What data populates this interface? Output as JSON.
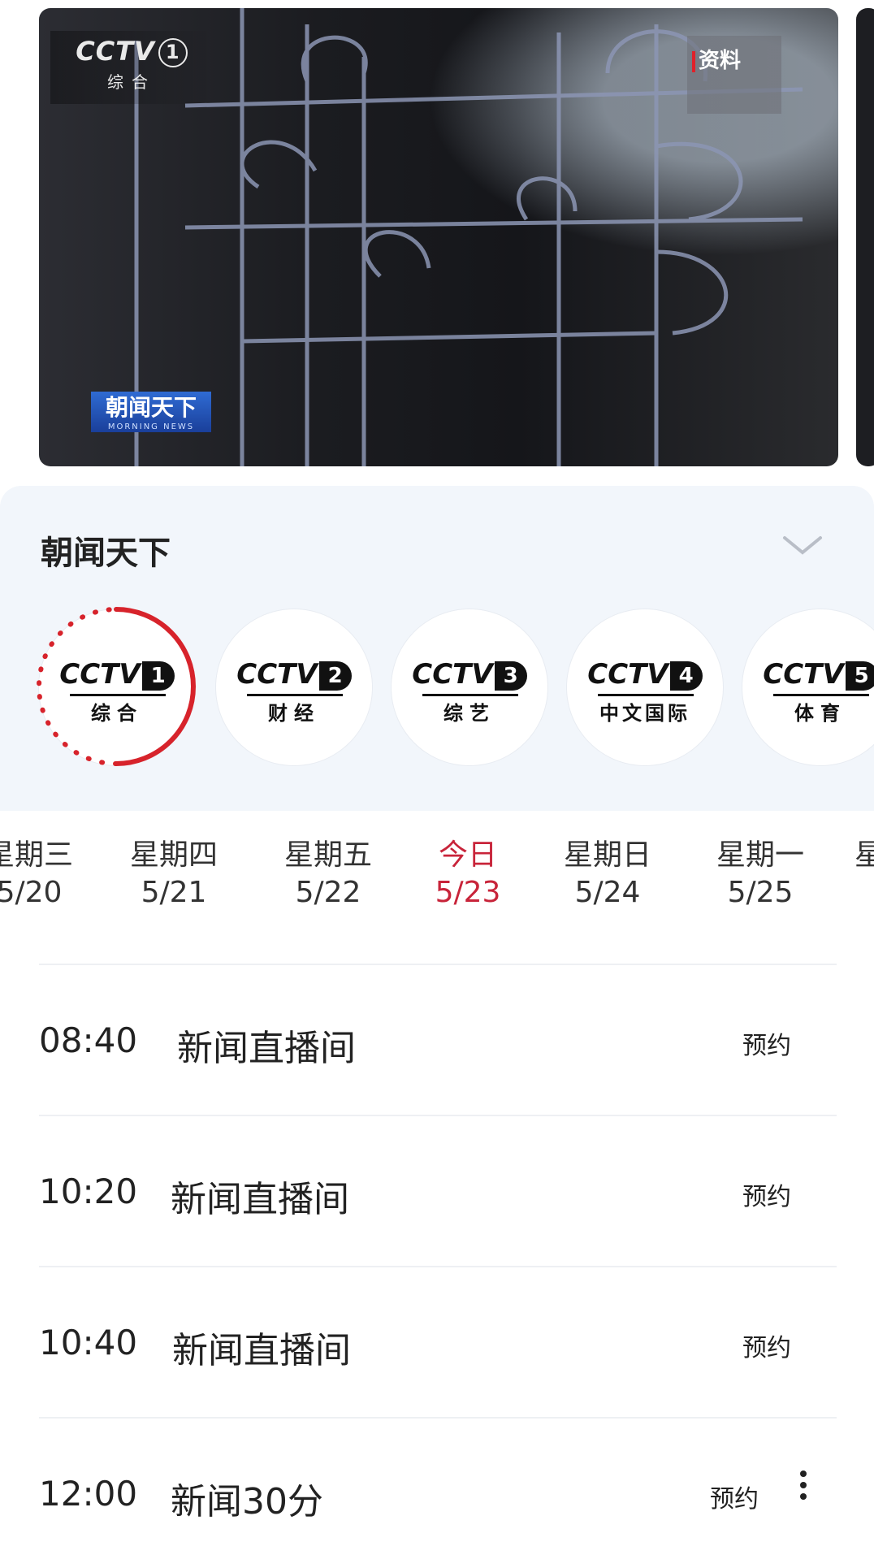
{
  "player": {
    "channel_logo": "CCTV",
    "channel_number": "1",
    "channel_subtitle": "综合",
    "overlay_tag": "资料",
    "show_badge": "朝闻天下",
    "show_badge_en": "MORNING NEWS"
  },
  "program": {
    "title": "朝闻天下"
  },
  "channels": [
    {
      "logo": "CCTV",
      "number": "1",
      "name": "综合",
      "selected": true
    },
    {
      "logo": "CCTV",
      "number": "2",
      "name": "财经"
    },
    {
      "logo": "CCTV",
      "number": "3",
      "name": "综艺"
    },
    {
      "logo": "CCTV",
      "number": "4",
      "name": "中文国际"
    },
    {
      "logo": "CCTV",
      "number": "5",
      "name": "体育"
    }
  ],
  "dates": [
    {
      "weekday": "星期三",
      "date": "5/20"
    },
    {
      "weekday": "星期四",
      "date": "5/21"
    },
    {
      "weekday": "星期五",
      "date": "5/22"
    },
    {
      "weekday": "今日",
      "date": "5/23",
      "today": true
    },
    {
      "weekday": "星期日",
      "date": "5/24"
    },
    {
      "weekday": "星期一",
      "date": "5/25"
    },
    {
      "weekday": "星",
      "date": ""
    }
  ],
  "schedule": [
    {
      "time": "08:40",
      "title": "新闻直播间",
      "action": "预约"
    },
    {
      "time": "10:20",
      "title": "新闻直播间",
      "action": "预约"
    },
    {
      "time": "10:40",
      "title": "新闻直播间",
      "action": "预约"
    },
    {
      "time": "12:00",
      "title": "新闻30分",
      "action": "预约"
    }
  ],
  "colors": {
    "accent": "#c8243a",
    "panel_bg": "#f2f6fb",
    "ring": "#d7232b"
  },
  "icons": {
    "collapse": "chevron-down-icon",
    "more": "more-vertical-icon"
  }
}
